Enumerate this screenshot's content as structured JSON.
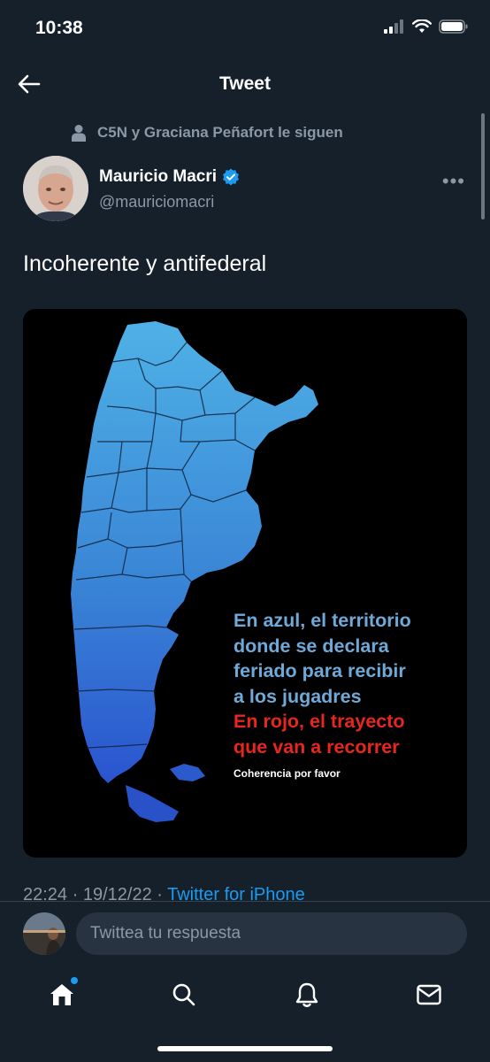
{
  "status_bar": {
    "time": "10:38"
  },
  "nav": {
    "title": "Tweet"
  },
  "social_context": "C5N y Graciana Peñafort le siguen",
  "author": {
    "name": "Mauricio Macri",
    "handle": "@mauriciomacri",
    "verified": true
  },
  "tweet": {
    "text": "Incoherente y antifederal"
  },
  "media": {
    "caption_blue": [
      "En azul, el territorio",
      "donde se declara",
      "feriado para recibir",
      "a los jugadres"
    ],
    "caption_red": [
      "En rojo, el trayecto",
      "que van a recorrer"
    ],
    "caption_small": "Coherencia por favor"
  },
  "meta": {
    "time": "22:24",
    "date": "19/12/22",
    "source": "Twitter for iPhone"
  },
  "reply": {
    "placeholder": "Twittea tu respuesta"
  },
  "tabs": [
    {
      "name": "home",
      "icon": "home-icon",
      "has_notification_dot": true
    },
    {
      "name": "search",
      "icon": "search-icon"
    },
    {
      "name": "notifications",
      "icon": "bell-icon"
    },
    {
      "name": "messages",
      "icon": "mail-icon"
    }
  ],
  "colors": {
    "background": "#15202b",
    "accent": "#1d9bf0",
    "muted": "#8b98a5",
    "map_blue": "#3a84d8",
    "caption_red": "#e8271c"
  }
}
